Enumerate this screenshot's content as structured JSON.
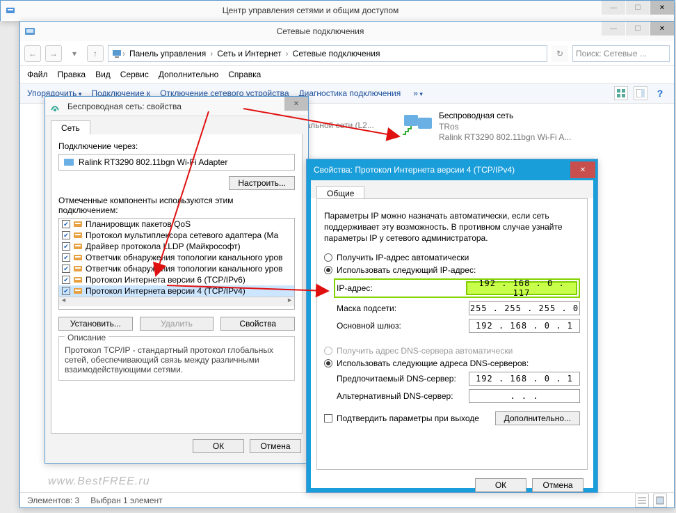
{
  "win1": {
    "title": "Центр управления сетями и общим доступом"
  },
  "win2": {
    "title": "Сетевые подключения",
    "breadcrumb": [
      "Панель управления",
      "Сеть и Интернет",
      "Сетевые подключения"
    ],
    "search_placeholder": "Поиск: Сетевые ...",
    "menubar": [
      "Файл",
      "Правка",
      "Вид",
      "Сервис",
      "Дополнительно",
      "Справка"
    ],
    "toolbar": [
      "Упорядочить",
      "Подключение к",
      "Отключение сетевого устройства",
      "Диагностика подключения"
    ],
    "connections": [
      {
        "name": "",
        "line2": "лобальной сети (L2...",
        "line3": ""
      },
      {
        "name": "Беспроводная сеть",
        "line2": "TRos",
        "line3": "Ralink RT3290 802.11bgn Wi-Fi A..."
      }
    ],
    "status_items": "Элементов: 3",
    "status_selected": "Выбран 1 элемент",
    "watermark": "www.BestFREE.ru"
  },
  "win3": {
    "title": "Беспроводная сеть: свойства",
    "tab": "Сеть",
    "label_connect_via": "Подключение через:",
    "adapter": "Ralink RT3290 802.11bgn Wi-Fi Adapter",
    "btn_configure": "Настроить...",
    "label_components": "Отмеченные компоненты используются этим подключением:",
    "components": [
      {
        "checked": true,
        "label": "Планировщик пакетов QoS"
      },
      {
        "checked": true,
        "label": "Протокол мультиплексора сетевого адаптера (Ма"
      },
      {
        "checked": true,
        "label": "Драйвер протокола LLDP (Майкрософт)"
      },
      {
        "checked": true,
        "label": "Ответчик обнаружения топологии канального уров"
      },
      {
        "checked": true,
        "label": "Ответчик обнаружения топологии канального уров"
      },
      {
        "checked": true,
        "label": "Протокол Интернета версии 6 (TCP/IPv6)"
      },
      {
        "checked": true,
        "label": "Протокол Интернета версии 4 (TCP/IPv4)"
      }
    ],
    "btn_install": "Установить...",
    "btn_remove": "Удалить",
    "btn_props": "Свойства",
    "group_desc_title": "Описание",
    "desc": "Протокол TCP/IP - стандартный протокол глобальных сетей, обеспечивающий связь между различными взаимодействующими сетями.",
    "btn_ok": "ОК",
    "btn_cancel": "Отмена"
  },
  "win4": {
    "title": "Свойства: Протокол Интернета версии 4 (TCP/IPv4)",
    "tab": "Общие",
    "desc": "Параметры IP можно назначать автоматически, если сеть поддерживает эту возможность. В противном случае узнайте параметры IP у сетевого администратора.",
    "radio_auto_ip": "Получить IP-адрес автоматически",
    "radio_manual_ip": "Использовать следующий IP-адрес:",
    "lbl_ip": "IP-адрес:",
    "val_ip": "192 . 168 .  0  . 117",
    "lbl_mask": "Маска подсети:",
    "val_mask": "255 . 255 . 255 .  0",
    "lbl_gw": "Основной шлюз:",
    "val_gw": "192 . 168 .  0  .  1",
    "radio_auto_dns": "Получить адрес DNS-сервера автоматически",
    "radio_manual_dns": "Использовать следующие адреса DNS-серверов:",
    "lbl_dns1": "Предпочитаемый DNS-сервер:",
    "val_dns1": "192 . 168 .  0  .  1",
    "lbl_dns2": "Альтернативный DNS-сервер:",
    "val_dns2": " .       .       .",
    "chk_validate": "Подтвердить параметры при выходе",
    "btn_advanced": "Дополнительно...",
    "btn_ok": "ОК",
    "btn_cancel": "Отмена"
  }
}
